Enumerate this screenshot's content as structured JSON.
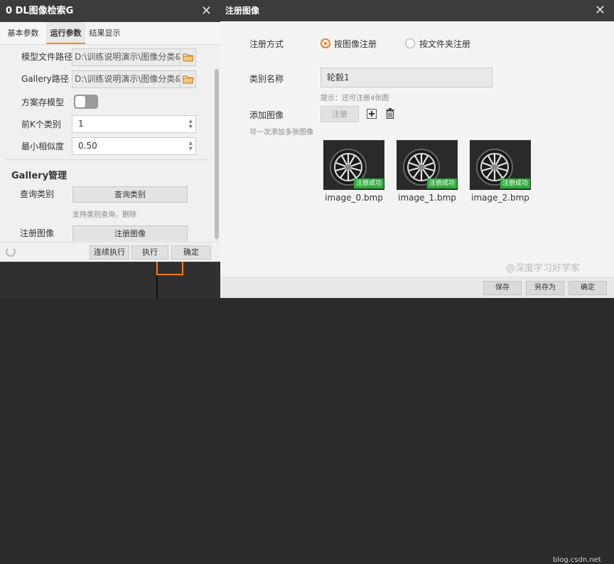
{
  "left_panel": {
    "title": "0 DL图像检索G",
    "tabs": [
      {
        "label": "基本参数"
      },
      {
        "label": "运行参数"
      },
      {
        "label": "结果显示"
      }
    ],
    "model_path": {
      "label": "模型文件路径",
      "value": "D:\\训练说明演示\\图像分类&"
    },
    "gallery_path": {
      "label": "Gallery路径",
      "value": "D:\\训练说明演示\\图像分类&"
    },
    "save_model": {
      "label": "方案存模型"
    },
    "topk": {
      "label": "前K个类别",
      "value": "1"
    },
    "min_sim": {
      "label": "最小相似度",
      "value": "0.50"
    },
    "gallery_section": {
      "title": "Gallery管理"
    },
    "query_category": {
      "label": "查询类别",
      "button": "查询类别",
      "hint": "支持类别查询，删除"
    },
    "register_image": {
      "label": "注册图像",
      "button": "注册图像"
    },
    "footer": {
      "continuous": "连续执行",
      "execute": "执行",
      "confirm": "确定"
    }
  },
  "right_dialog": {
    "title": "注册图像",
    "register_mode": {
      "label": "注册方式",
      "option1": "按图像注册",
      "option2": "按文件夹注册",
      "selected": "option1"
    },
    "category_name": {
      "label": "类别名称",
      "value": "轮毂1",
      "hint": "提示：还可注册4张图"
    },
    "add_image": {
      "label": "添加图像",
      "button": "注册",
      "hint": "可一次添加多张图像"
    },
    "images": [
      {
        "name": "image_0.bmp",
        "badge": "注册成功"
      },
      {
        "name": "image_1.bmp",
        "badge": "注册成功"
      },
      {
        "name": "image_2.bmp",
        "badge": "注册成功"
      }
    ],
    "footer": {
      "save": "保存",
      "save_as": "另存为",
      "confirm": "确定"
    },
    "watermark": "@深度学习好学家",
    "watermark2": "blog.csdn.net"
  },
  "colors": {
    "accent": "#ff7a1a",
    "success": "#2fae3c",
    "titlebar": "#3c3c3c"
  }
}
